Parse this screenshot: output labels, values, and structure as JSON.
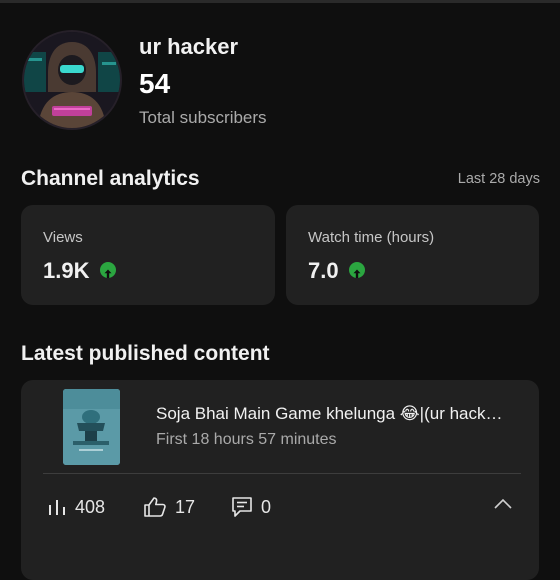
{
  "channel": {
    "name": "ur hacker",
    "subscriber_count": "54",
    "subscriber_label": "Total subscribers",
    "avatar_icon": "hacker-avatar"
  },
  "analytics": {
    "title": "Channel analytics",
    "range": "Last 28 days",
    "cards": [
      {
        "label": "Views",
        "value": "1.9K",
        "trend": "up"
      },
      {
        "label": "Watch time (hours)",
        "value": "7.0",
        "trend": "up"
      }
    ],
    "trend_color": "#2ba640"
  },
  "latest": {
    "title": "Latest published content",
    "video": {
      "title": "Soja Bhai Main Game khelunga 😂|(ur hack…",
      "time": "First 18 hours 57 minutes",
      "views": "408",
      "likes": "17",
      "comments": "0"
    }
  },
  "colors": {
    "background": "#0f0f0f",
    "card": "#212121",
    "secondary_text": "#aaaaaa"
  }
}
